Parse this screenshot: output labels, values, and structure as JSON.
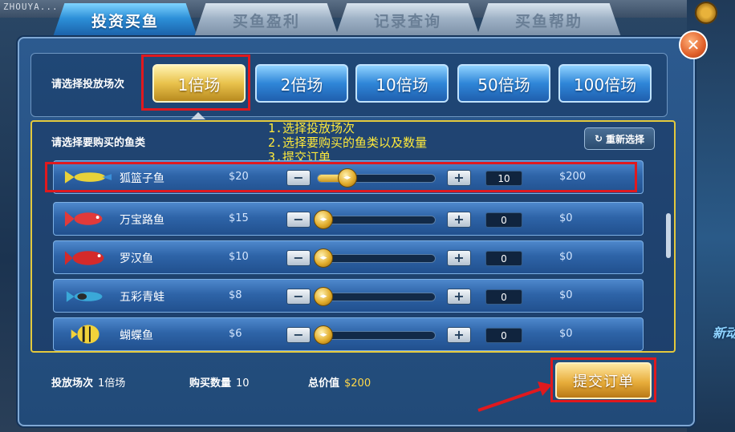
{
  "background": {
    "top_left_text": "ZHOUYA..."
  },
  "tabs": [
    {
      "label": "投资买鱼",
      "active": true
    },
    {
      "label": "买鱼盈利",
      "active": false
    },
    {
      "label": "记录查询",
      "active": false
    },
    {
      "label": "买鱼帮助",
      "active": false
    }
  ],
  "close_icon": "close-icon",
  "session": {
    "label": "请选择投放场次",
    "options": [
      "1倍场",
      "2倍场",
      "10倍场",
      "50倍场",
      "100倍场"
    ],
    "selected": "1倍场"
  },
  "fish_section": {
    "label": "请选择要购买的鱼类",
    "reset_label": "重新选择",
    "instructions": [
      "1.选择投放场次",
      "2.选择要购买的鱼类以及数量",
      "3.提交订单"
    ]
  },
  "fish_rows": [
    {
      "name": "狐篮子鱼",
      "price": "$20",
      "quantity": "10",
      "total": "$200",
      "slider_fraction": 0.2,
      "icon": "fox-fish-icon",
      "color": "#e8d23a"
    },
    {
      "name": "万宝路鱼",
      "price": "$15",
      "quantity": "0",
      "total": "$0",
      "slider_fraction": 0,
      "icon": "red-fish-icon",
      "color": "#e23a3a"
    },
    {
      "name": "罗汉鱼",
      "price": "$10",
      "quantity": "0",
      "total": "$0",
      "slider_fraction": 0,
      "icon": "luohan-fish-icon",
      "color": "#d42a2a"
    },
    {
      "name": "五彩青蛙",
      "price": "$8",
      "quantity": "0",
      "total": "$0",
      "slider_fraction": 0,
      "icon": "colorful-frog-icon",
      "color": "#3aa8d8"
    },
    {
      "name": "蝴蝶鱼",
      "price": "$6",
      "quantity": "0",
      "total": "$0",
      "slider_fraction": 0,
      "icon": "butterfly-fish-icon",
      "color": "#f2d23a"
    }
  ],
  "footer": {
    "session_label": "投放场次",
    "session_value": "1倍场",
    "quantity_label": "购买数量",
    "quantity_value": "10",
    "total_label": "总价值",
    "total_value": "$200"
  },
  "submit_label": "提交订单",
  "colors": {
    "highlight_red": "#e0191e",
    "instruction_yellow": "#ffea3a",
    "accent_gold": "#e9c24c"
  }
}
